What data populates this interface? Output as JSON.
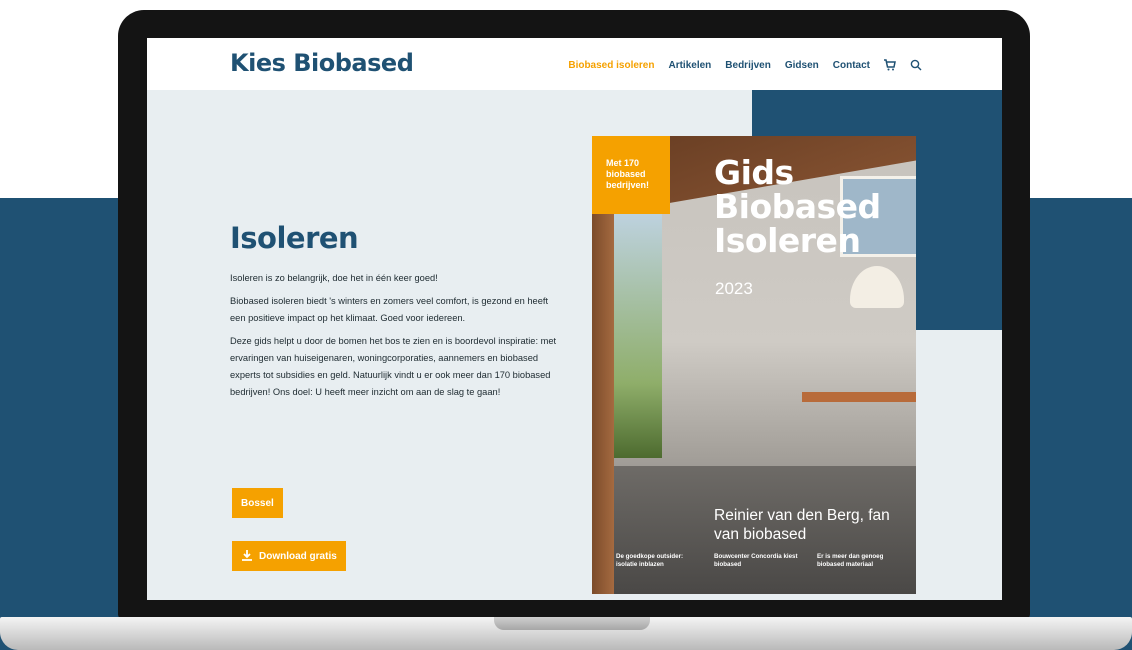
{
  "colors": {
    "brand_blue": "#1f5173",
    "accent_orange": "#f5a100",
    "screen_bg": "#e8eef1",
    "text_dark": "#1d2a30"
  },
  "header": {
    "logo": "Kies Biobased",
    "nav": [
      {
        "label": "Biobased isoleren",
        "active": true
      },
      {
        "label": "Artikelen",
        "active": false
      },
      {
        "label": "Bedrijven",
        "active": false
      },
      {
        "label": "Gidsen",
        "active": false
      },
      {
        "label": "Contact",
        "active": false
      }
    ],
    "icons": [
      "cart-icon",
      "search-icon"
    ]
  },
  "hero": {
    "title": "Isoleren",
    "paragraphs": [
      "Isoleren is zo belangrijk, doe het in één keer goed!",
      "Biobased isoleren biedt 's winters en zomers veel comfort, is gezond en heeft een positieve impact op het klimaat. Goed voor iedereen.",
      "Deze gids helpt u door de bomen het bos te zien en is boordevol inspiratie: met ervaringen van huiseigenaren, woningcorporaties, aannemers en biobased experts tot subsidies en geld. Natuurlijk vindt u er ook meer dan 170 biobased bedrijven! Ons doel: U heeft meer inzicht om aan de slag te gaan!"
    ],
    "browse_button": "Bossel",
    "download_button": "Download gratis",
    "download_icon": "download-icon"
  },
  "cover": {
    "badge": "Met 170 biobased bedrijven!",
    "title_lines": [
      "Gids",
      "Biobased",
      "Isoleren"
    ],
    "year": "2023",
    "quote": "Reinier van den Berg, fan van biobased",
    "teasers": [
      "De goedkope outsider: isolatie inblazen",
      "Bouwcenter Concordia kiest biobased",
      "Er is meer dan genoeg biobased materiaal"
    ]
  }
}
